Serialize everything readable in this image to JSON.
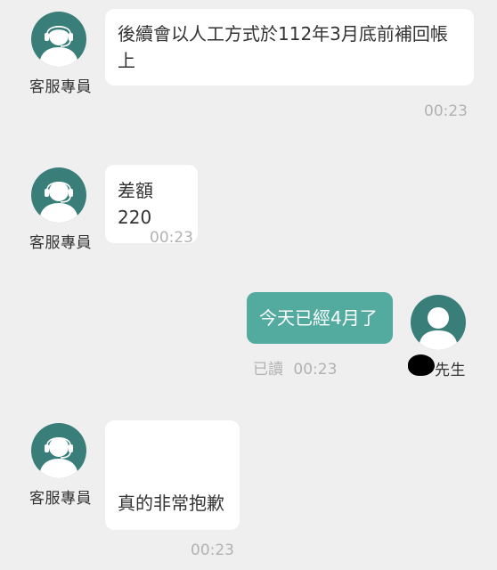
{
  "colors": {
    "background": "#efefef",
    "agent_avatar": "#3a7e7a",
    "user_avatar": "#3a7e7a",
    "outgoing_bubble": "#53aba0",
    "incoming_bubble": "#ffffff",
    "timestamp": "#b2b2b2"
  },
  "messages": [
    {
      "sender": "客服專員",
      "avatar_icon": "headset-agent-icon",
      "text": "後續會以人工方式於112年3月底前補回帳上",
      "time": "00:23"
    },
    {
      "sender": "客服專員",
      "avatar_icon": "headset-agent-icon",
      "text": "差額220",
      "time": "00:23"
    },
    {
      "sender": "先生",
      "avatar_icon": "user-icon",
      "text": "今天已經4月了",
      "read_label": "已讀",
      "time": "00:23"
    },
    {
      "sender": "客服專員",
      "avatar_icon": "headset-agent-icon",
      "text": "真的非常抱歉",
      "time": "00:23"
    }
  ]
}
